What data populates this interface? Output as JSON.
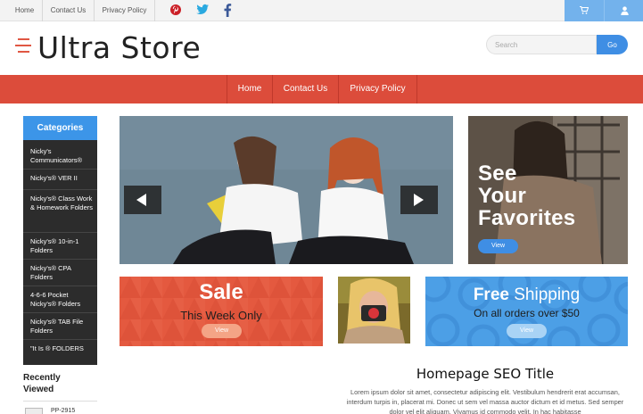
{
  "top_nav": {
    "links": [
      "Home",
      "Contact Us",
      "Privacy Policy"
    ]
  },
  "social": [
    {
      "name": "pinterest-icon",
      "glyph": "P",
      "color": "#cb2027"
    },
    {
      "name": "twitter-icon",
      "glyph": "t",
      "color": "#2aa9e0"
    },
    {
      "name": "facebook-icon",
      "glyph": "f",
      "color": "#3b5998"
    }
  ],
  "header": {
    "logo": "Ultra Store",
    "search_placeholder": "Search",
    "search_button": "Go"
  },
  "main_nav": {
    "items": [
      "Home",
      "Contact Us",
      "Privacy Policy"
    ]
  },
  "sidebar": {
    "categories_title": "Categories",
    "categories": [
      "Nicky's Communicators®",
      "Nicky's® VER II",
      "Nicky's® Class Work & Homework Folders",
      "Nicky's® 10-in-1 Folders",
      "Nicky's® CPA Folders",
      "4-6-6 Pocket Nicky's® Folders",
      "Nicky's® TAB File Folders",
      "\"It Is ® FOLDERS"
    ],
    "recently_viewed_title": "Recently Viewed",
    "recent_item": "PP-2915"
  },
  "promos": {
    "favorites": {
      "text": "See Your Favorites",
      "lines": [
        "See",
        "Your",
        "Favorites"
      ],
      "button": "View"
    },
    "sale": {
      "title": "Sale",
      "subtitle": "This Week Only",
      "button": "View"
    },
    "shipping": {
      "title_bold": "Free",
      "title_rest": "Shipping",
      "subtitle": "On all orders over $50",
      "button": "View"
    }
  },
  "seo": {
    "title": "Homepage SEO Title",
    "text": "Lorem ipsum dolor sit amet, consectetur adipiscing elit. Vestibulum hendrerit erat accumsan, interdum turpis in, placerat mi. Donec ut sem vel massa auctor dictum et id metus. Sed semper dolor vel elit aliquam. Vivamus id commodo velit. In hac habitasse"
  },
  "colors": {
    "accent_red": "#dc4c3b",
    "accent_blue": "#3c95e8",
    "sidebar_dark": "#2c2c2c"
  }
}
